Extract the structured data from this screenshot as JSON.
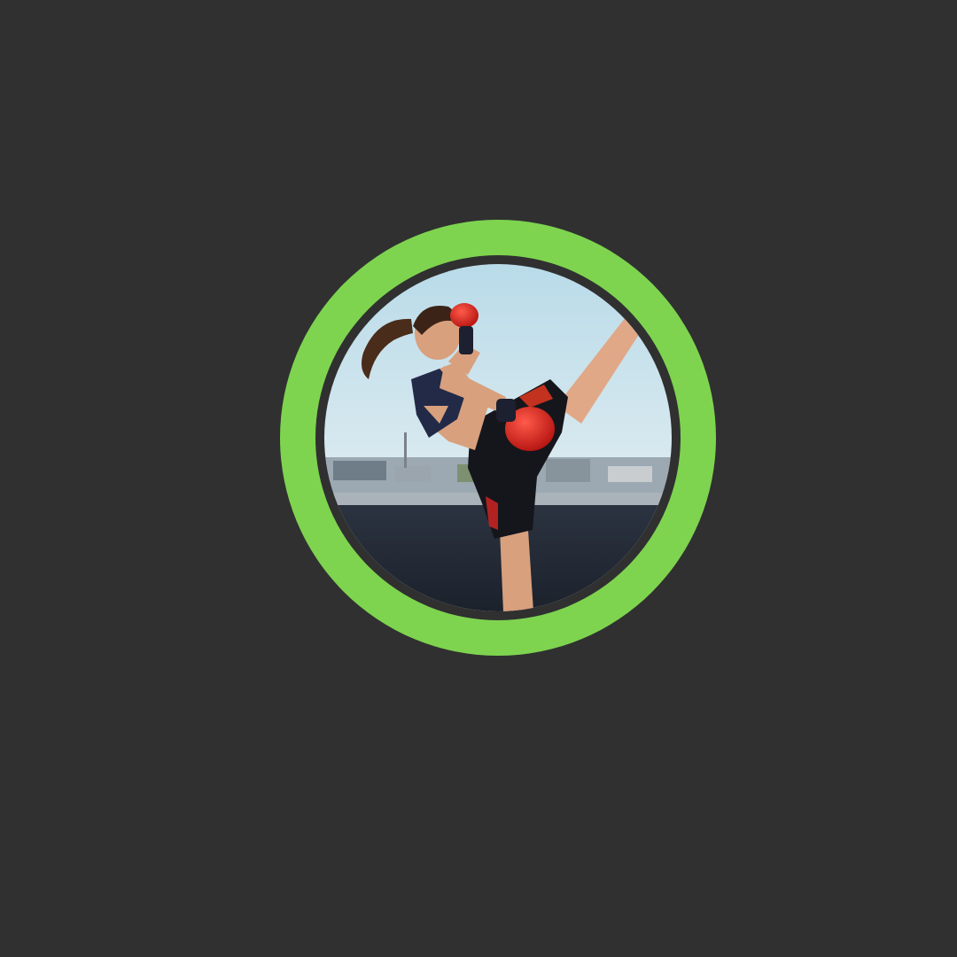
{
  "profile": {
    "avatar_icon": "kickboxer-photo",
    "ring_color": "#7ed44f",
    "background_color": "#303030"
  }
}
